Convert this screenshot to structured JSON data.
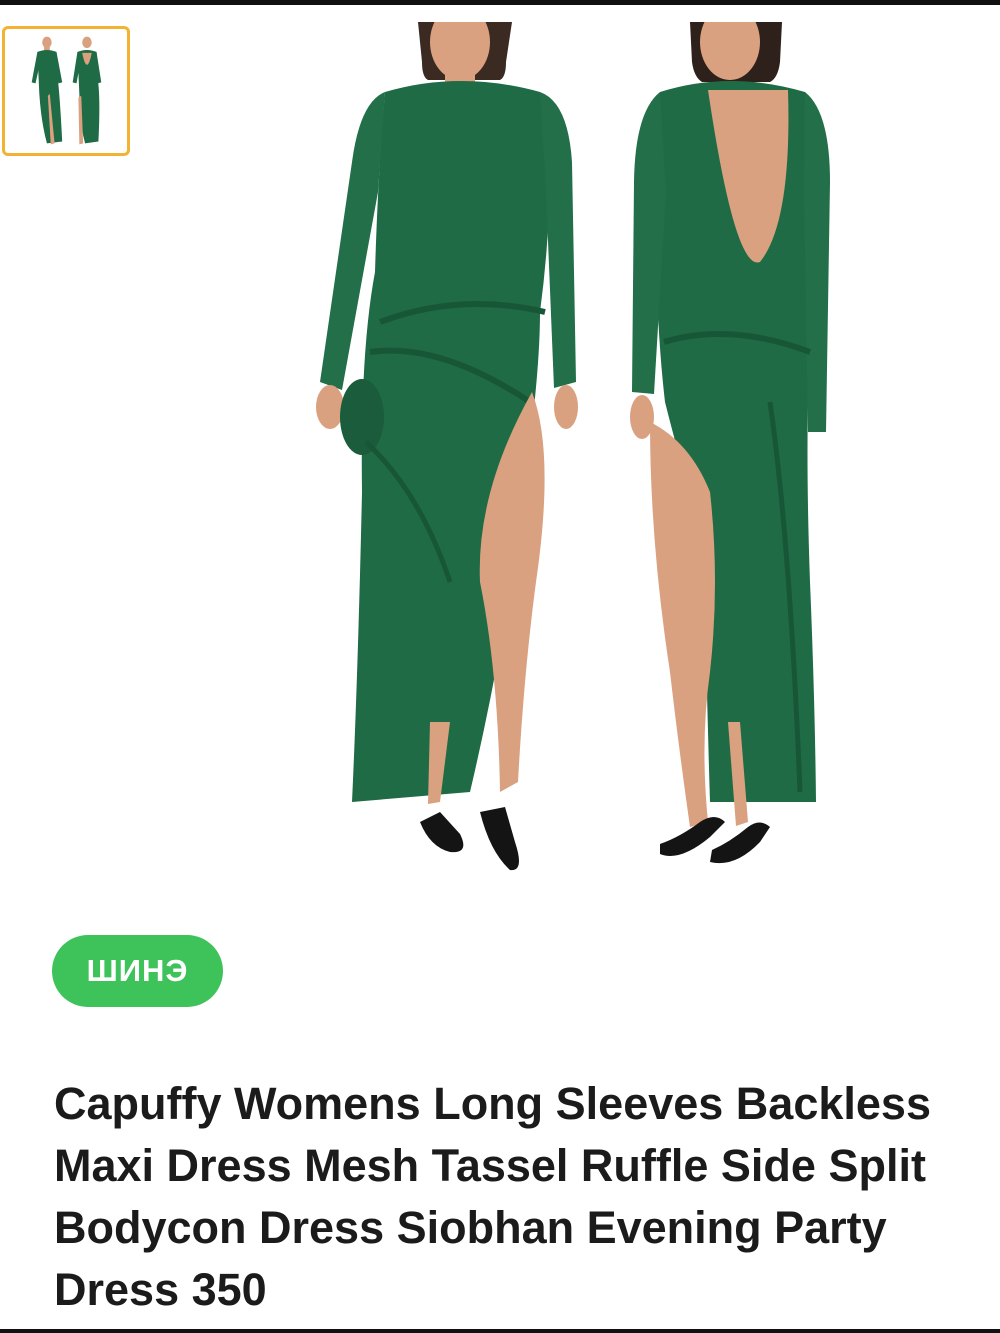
{
  "product": {
    "badge_label": "ШИНЭ",
    "title": "Capuffy Womens Long Sleeves Backless Maxi Dress Mesh Tassel Ruffle Side Split Bodycon Dress Siobhan Evening Party Dress 350"
  },
  "gallery": {
    "selected_index": 0,
    "thumbnail_count": 1
  },
  "colors": {
    "dress_green": "#1f6b45",
    "badge_green": "#3ec25a",
    "thumb_border": "#f2b233",
    "skin": "#d9a17f"
  }
}
